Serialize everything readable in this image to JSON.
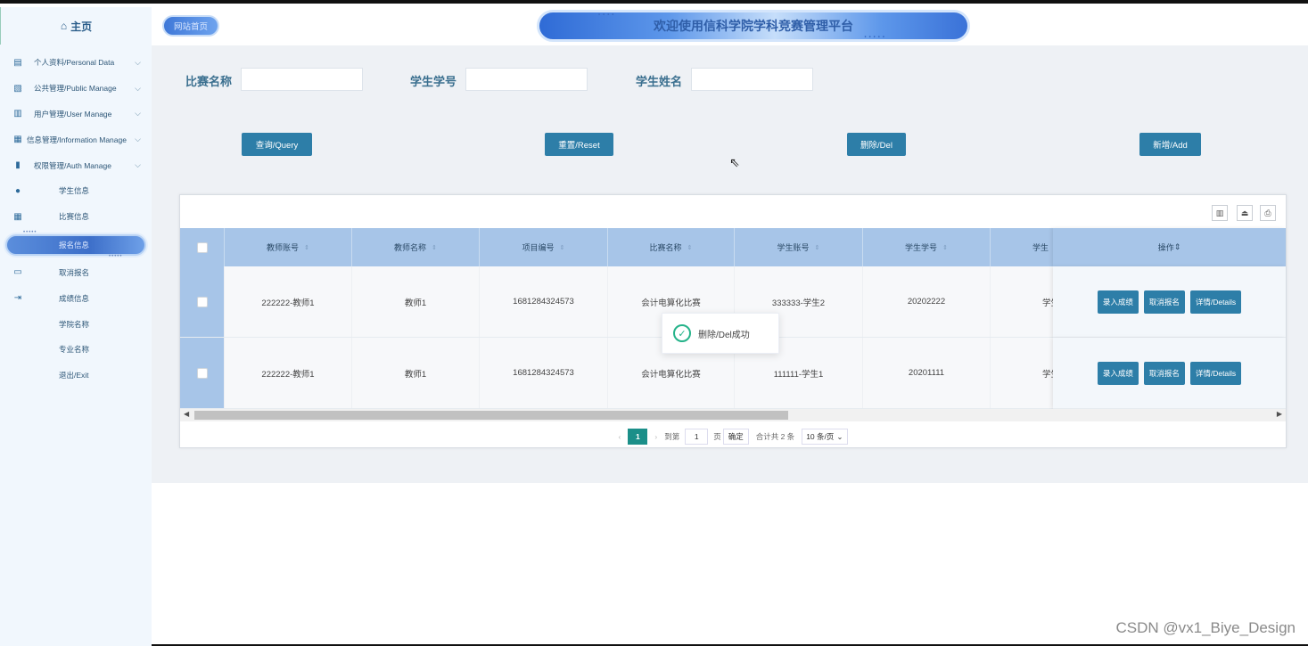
{
  "sidebar": {
    "home_label": "主页",
    "items": [
      {
        "label": "个人资料/Personal Data",
        "icon": "doc",
        "chev": "⌵"
      },
      {
        "label": "公共管理/Public Manage",
        "icon": "clipboard",
        "chev": "⌵"
      },
      {
        "label": "用户管理/User Manage",
        "icon": "users",
        "chev": "⌵"
      },
      {
        "label": "信息管理/Information Manage",
        "icon": "chart",
        "chev": "⌵"
      },
      {
        "label": "权限管理/Auth Manage",
        "icon": "bookmark",
        "chev": "⌵"
      },
      {
        "label": "学生信息",
        "icon": "person"
      },
      {
        "label": "比赛信息",
        "icon": "calendar"
      },
      {
        "label": "报名信息",
        "active": true
      },
      {
        "label": "取消报名",
        "icon": "book"
      },
      {
        "label": "成绩信息",
        "icon": "logout"
      },
      {
        "label": "学院名称"
      },
      {
        "label": "专业名称"
      },
      {
        "label": "退出/Exit"
      }
    ]
  },
  "header": {
    "home_button": "网站首页",
    "title": "欢迎使用信科学院学科竞赛管理平台"
  },
  "search": {
    "labels": [
      "比赛名称",
      "学生学号",
      "学生姓名"
    ],
    "values": [
      "",
      "",
      ""
    ]
  },
  "actions": {
    "query": "查询/Query",
    "reset": "重置/Reset",
    "delete": "删除/Del",
    "add": "新增/Add"
  },
  "table": {
    "columns": [
      "教师账号",
      "教师名称",
      "项目编号",
      "比赛名称",
      "学生账号",
      "学生学号",
      "学生"
    ],
    "ops_header": "操作",
    "rows": [
      {
        "cells": [
          "222222-教师1",
          "教师1",
          "1681284324573",
          "会计电算化比赛",
          "333333-学生2",
          "20202222",
          "学生"
        ]
      },
      {
        "cells": [
          "222222-教师1",
          "教师1",
          "1681284324573",
          "会计电算化比赛",
          "111111-学生1",
          "20201111",
          "学生"
        ]
      }
    ],
    "row_actions": [
      "录入成绩",
      "取消报名",
      "详情/Details"
    ]
  },
  "pagination": {
    "current_page": "1",
    "goto_label": "到第",
    "goto_value": "1",
    "page_unit": "页",
    "confirm": "确定",
    "total": "合计共 2 条",
    "page_size": "10 条/页"
  },
  "toast": {
    "message": "删除/Del成功"
  },
  "watermark": "CSDN @vx1_Biye_Design",
  "colors": {
    "accent": "#2d7ea8",
    "header_row": "#a7c5e8",
    "page_current": "#1b8f89",
    "success": "#26b38a"
  }
}
